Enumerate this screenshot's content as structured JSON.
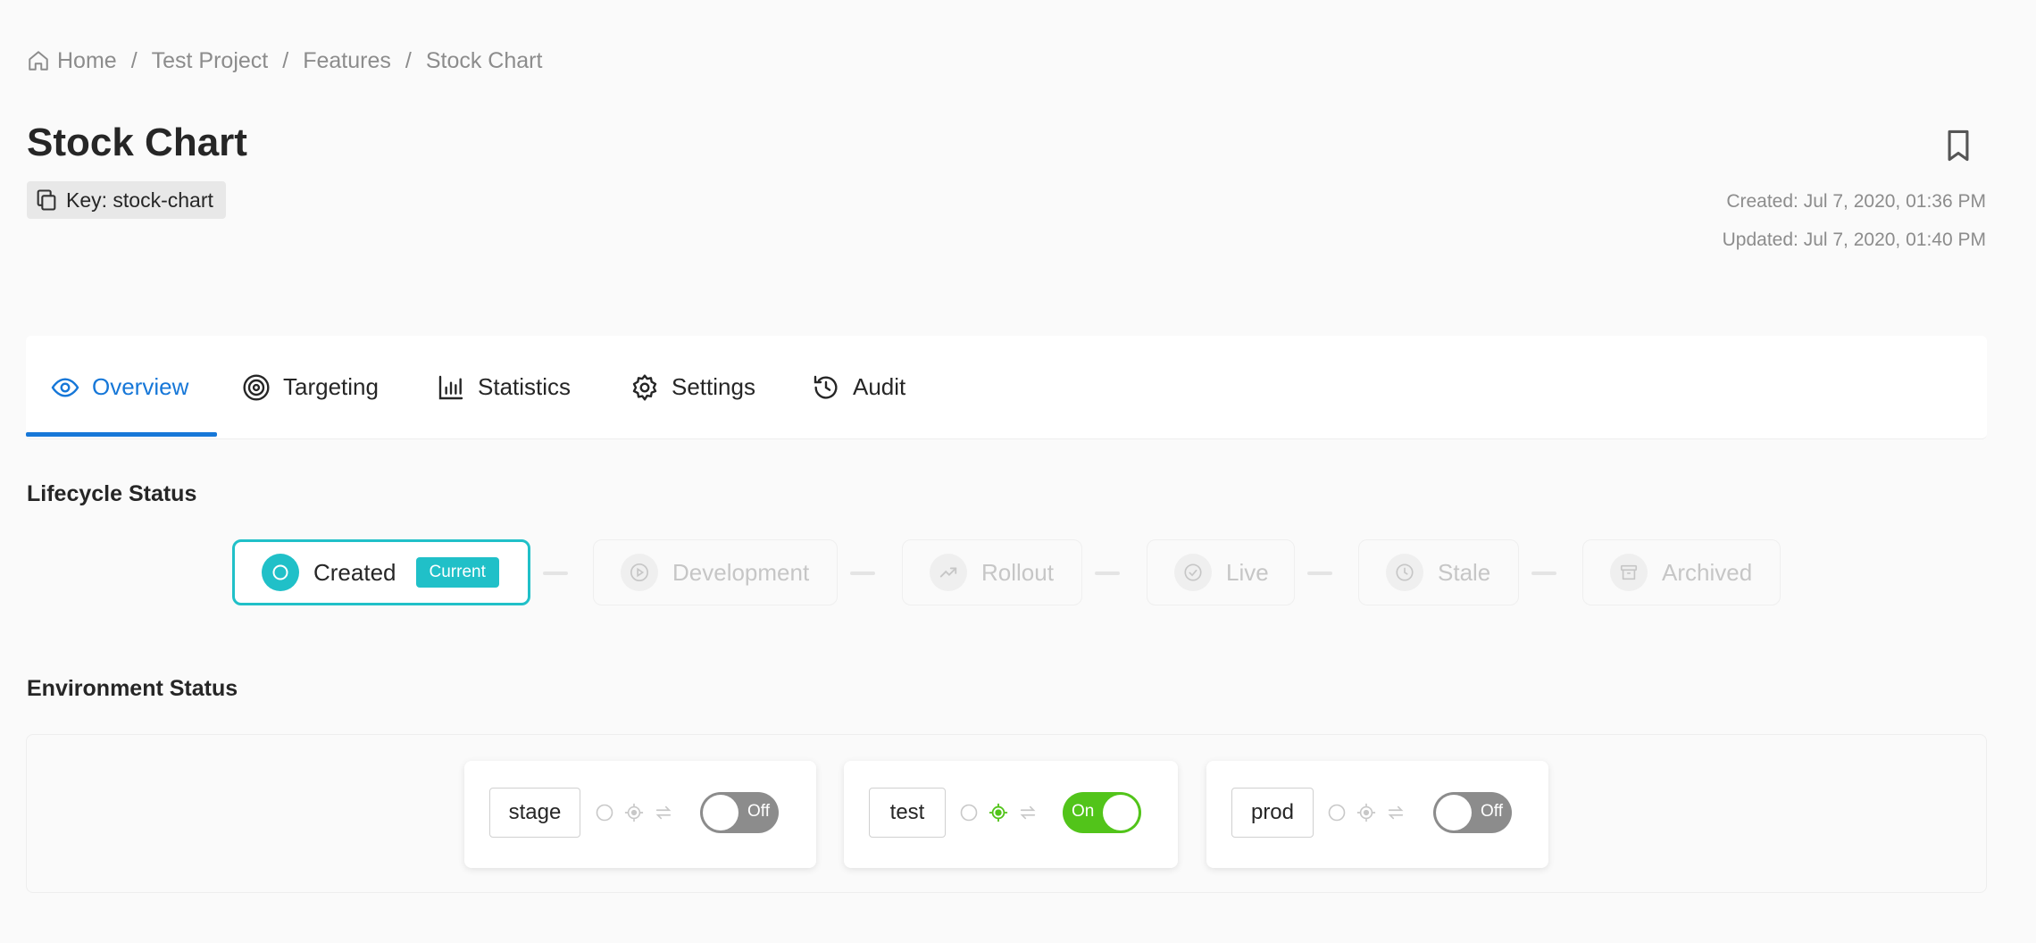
{
  "breadcrumb": [
    {
      "label": "Home"
    },
    {
      "label": "Test Project"
    },
    {
      "label": "Features"
    },
    {
      "label": "Stock Chart"
    }
  ],
  "breadcrumb_separator": "/",
  "header": {
    "title": "Stock Chart",
    "key_label": "Key: stock-chart",
    "created": "Created: Jul 7, 2020, 01:36 PM",
    "updated": "Updated: Jul 7, 2020, 01:40 PM"
  },
  "tabs": [
    {
      "label": "Overview",
      "icon": "eye-icon",
      "active": true
    },
    {
      "label": "Targeting",
      "icon": "target-icon",
      "active": false
    },
    {
      "label": "Statistics",
      "icon": "bar-chart-icon",
      "active": false
    },
    {
      "label": "Settings",
      "icon": "gear-icon",
      "active": false
    },
    {
      "label": "Audit",
      "icon": "history-icon",
      "active": false
    }
  ],
  "lifecycle": {
    "title": "Lifecycle Status",
    "current_badge": "Current",
    "stages": [
      {
        "label": "Created",
        "icon": "circle-icon",
        "current": true
      },
      {
        "label": "Development",
        "icon": "play-icon",
        "current": false
      },
      {
        "label": "Rollout",
        "icon": "trend-up-icon",
        "current": false
      },
      {
        "label": "Live",
        "icon": "check-circle-icon",
        "current": false
      },
      {
        "label": "Stale",
        "icon": "clock-icon",
        "current": false
      },
      {
        "label": "Archived",
        "icon": "archive-icon",
        "current": false
      }
    ]
  },
  "environments": {
    "title": "Environment Status",
    "items": [
      {
        "name": "stage",
        "enabled": false,
        "toggle_label": "Off",
        "targeting_active": false
      },
      {
        "name": "test",
        "enabled": true,
        "toggle_label": "On",
        "targeting_active": true
      },
      {
        "name": "prod",
        "enabled": false,
        "toggle_label": "Off",
        "targeting_active": false
      }
    ]
  },
  "colors": {
    "accent_blue": "#1677d8",
    "lifecycle_teal": "#20c0c8",
    "toggle_on": "#52c41a",
    "toggle_off": "#8c8c8c",
    "muted_text": "#8c8c8c"
  }
}
